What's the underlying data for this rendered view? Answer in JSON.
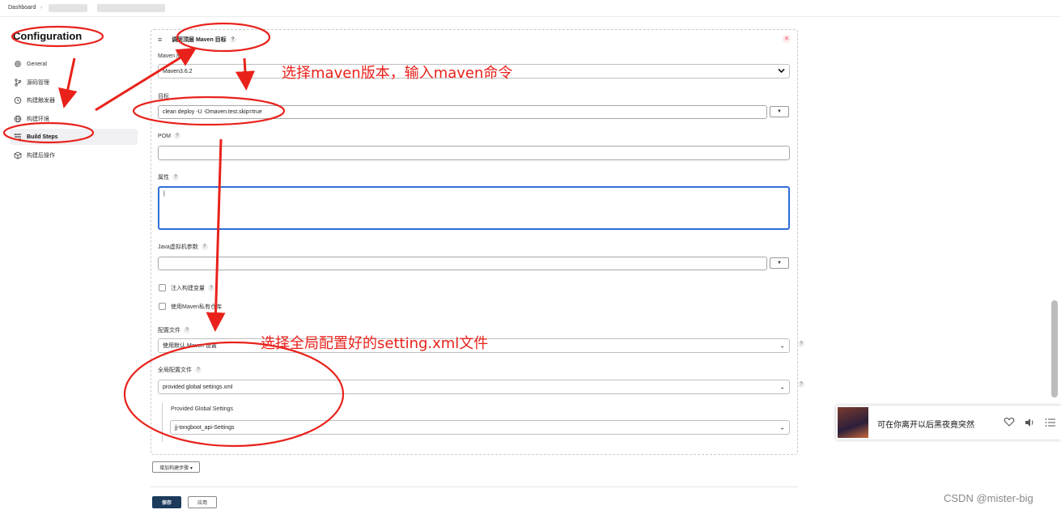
{
  "breadcrumb": {
    "home": "Dashboard",
    "separator": "›"
  },
  "sidebar": {
    "title": "Configuration",
    "items": [
      {
        "label": "General",
        "icon": "gear-icon"
      },
      {
        "label": "源码管理",
        "icon": "branch-icon"
      },
      {
        "label": "构建触发器",
        "icon": "clock-icon"
      },
      {
        "label": "构建环境",
        "icon": "globe-icon"
      },
      {
        "label": "Build Steps",
        "icon": "list-icon",
        "active": true
      },
      {
        "label": "构建后操作",
        "icon": "box-icon"
      }
    ]
  },
  "step": {
    "title": "调用顶层 Maven 目标",
    "help": "?",
    "close": "×",
    "maven_version": {
      "label": "Maven 版本",
      "value": "Maven3.6.2"
    },
    "goals": {
      "label": "目标",
      "value": "clean deploy -U -Dmaven.test.skip=true",
      "dropdown": "▼"
    },
    "pom": {
      "label": "POM",
      "value": ""
    },
    "properties": {
      "label": "属性",
      "value": "|"
    },
    "jvm": {
      "label": "Java虚拟机参数",
      "value": "",
      "dropdown": "▼"
    },
    "inject_vars": {
      "label": "注入构建变量"
    },
    "private_repo": {
      "label": "使用Maven私有仓库"
    },
    "settings": {
      "label": "配置文件",
      "value": "使用默认 Maven 设置"
    },
    "global_settings": {
      "label": "全局配置文件",
      "value": "provided global settings.xml"
    },
    "provided": {
      "label": "Provided Global Settings",
      "value": "jj-tongboot_api-Settings"
    }
  },
  "add_step_button": "增加构建步骤 ▾",
  "footer": {
    "save": "保存",
    "apply": "应用"
  },
  "annotations": {
    "maven": "选择maven版本，输入maven命令",
    "settings": "选择全局配置好的setting.xml文件"
  },
  "player": {
    "song": "可在你离开以后黑夜竟突然"
  },
  "watermark": "CSDN @mister-big",
  "colors": {
    "annotation": "#e8221b",
    "save_button": "#1b3a5c",
    "active_nav": "#efeff4"
  }
}
